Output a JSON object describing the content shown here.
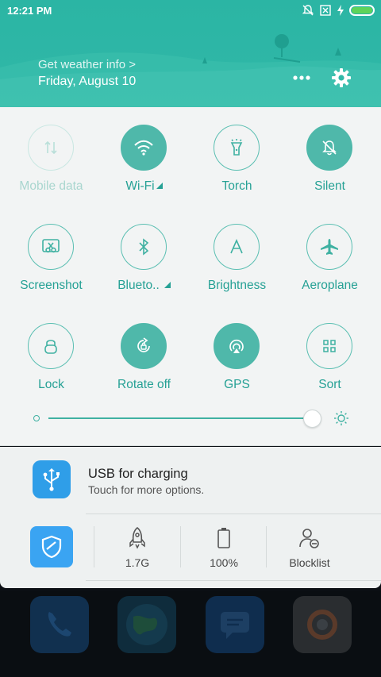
{
  "status_bar": {
    "time": "12:21 PM"
  },
  "header": {
    "weather_link": "Get weather info >",
    "date": "Friday, August 10"
  },
  "tiles": [
    {
      "label": "Mobile data",
      "state": "disabled",
      "icon": "mobile-data-icon"
    },
    {
      "label": "Wi-Fi",
      "state": "on",
      "icon": "wifi-icon"
    },
    {
      "label": "Torch",
      "state": "off",
      "icon": "torch-icon"
    },
    {
      "label": "Silent",
      "state": "on",
      "icon": "silent-bell-icon"
    },
    {
      "label": "Screenshot",
      "state": "off",
      "icon": "screenshot-icon"
    },
    {
      "label": "Blueto..",
      "state": "off",
      "icon": "bluetooth-icon"
    },
    {
      "label": "Brightness",
      "state": "off",
      "icon": "brightness-icon"
    },
    {
      "label": "Aeroplane",
      "state": "off",
      "icon": "aeroplane-icon"
    },
    {
      "label": "Lock",
      "state": "off",
      "icon": "lock-icon"
    },
    {
      "label": "Rotate off",
      "state": "on",
      "icon": "rotate-icon"
    },
    {
      "label": "GPS",
      "state": "on",
      "icon": "gps-icon"
    },
    {
      "label": "Sort",
      "state": "off",
      "icon": "sort-grid-icon"
    }
  ],
  "brightness": {
    "level": 0.97
  },
  "notification": {
    "title": "USB for charging",
    "subtitle": "Touch for more options."
  },
  "tools": {
    "memory": "1.7G",
    "battery": "100%",
    "blocklist": "Blocklist"
  },
  "colors": {
    "accent": "#30b8a8",
    "tile_on": "#4fb8aa",
    "label": "#26a195"
  }
}
